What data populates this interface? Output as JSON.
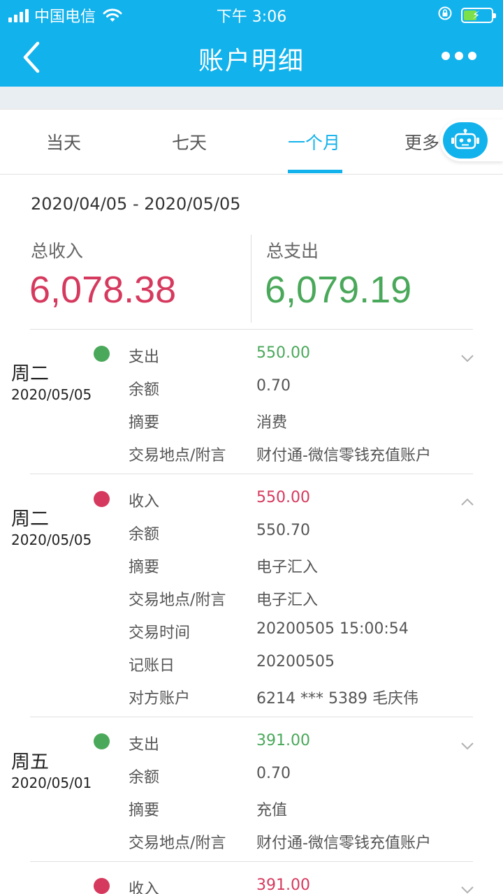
{
  "status_bar": {
    "carrier": "中国电信",
    "time": "下午 3:06"
  },
  "nav": {
    "title": "账户明细"
  },
  "tabs": [
    {
      "label": "当天",
      "active": false
    },
    {
      "label": "七天",
      "active": false
    },
    {
      "label": "一个月",
      "active": true
    },
    {
      "label": "更多",
      "active": false
    }
  ],
  "summary": {
    "date_range": "2020/04/05 - 2020/05/05",
    "income_label": "总收入",
    "income_value": "6,078.38",
    "expense_label": "总支出",
    "expense_value": "6,079.19"
  },
  "colors": {
    "brand": "#12b2ec",
    "income": "#d6395e",
    "expense": "#4aa85a"
  },
  "records": [
    {
      "weekday": "周二",
      "date": "2020/05/05",
      "type": "expense",
      "expanded": false,
      "fields": [
        {
          "label": "支出",
          "value": "550.00"
        },
        {
          "label": "余额",
          "value": "0.70"
        },
        {
          "label": "摘要",
          "value": "消费"
        },
        {
          "label": "交易地点/附言",
          "value": "财付通-微信零钱充值账户"
        }
      ]
    },
    {
      "weekday": "周二",
      "date": "2020/05/05",
      "type": "income",
      "expanded": true,
      "fields": [
        {
          "label": "收入",
          "value": "550.00"
        },
        {
          "label": "余额",
          "value": "550.70"
        },
        {
          "label": "摘要",
          "value": "电子汇入"
        },
        {
          "label": "交易地点/附言",
          "value": "电子汇入"
        },
        {
          "label": "交易时间",
          "value": "20200505 15:00:54"
        },
        {
          "label": "记账日",
          "value": "20200505"
        },
        {
          "label": "对方账户",
          "value": "6214 *** 5389 毛庆伟"
        }
      ]
    },
    {
      "weekday": "周五",
      "date": "2020/05/01",
      "type": "expense",
      "expanded": false,
      "fields": [
        {
          "label": "支出",
          "value": "391.00"
        },
        {
          "label": "余额",
          "value": "0.70"
        },
        {
          "label": "摘要",
          "value": "充值"
        },
        {
          "label": "交易地点/附言",
          "value": "财付通-微信零钱充值账户"
        }
      ]
    },
    {
      "weekday": "",
      "date": "",
      "type": "income",
      "expanded": false,
      "fields": [
        {
          "label": "收入",
          "value": "391.00"
        }
      ]
    }
  ]
}
